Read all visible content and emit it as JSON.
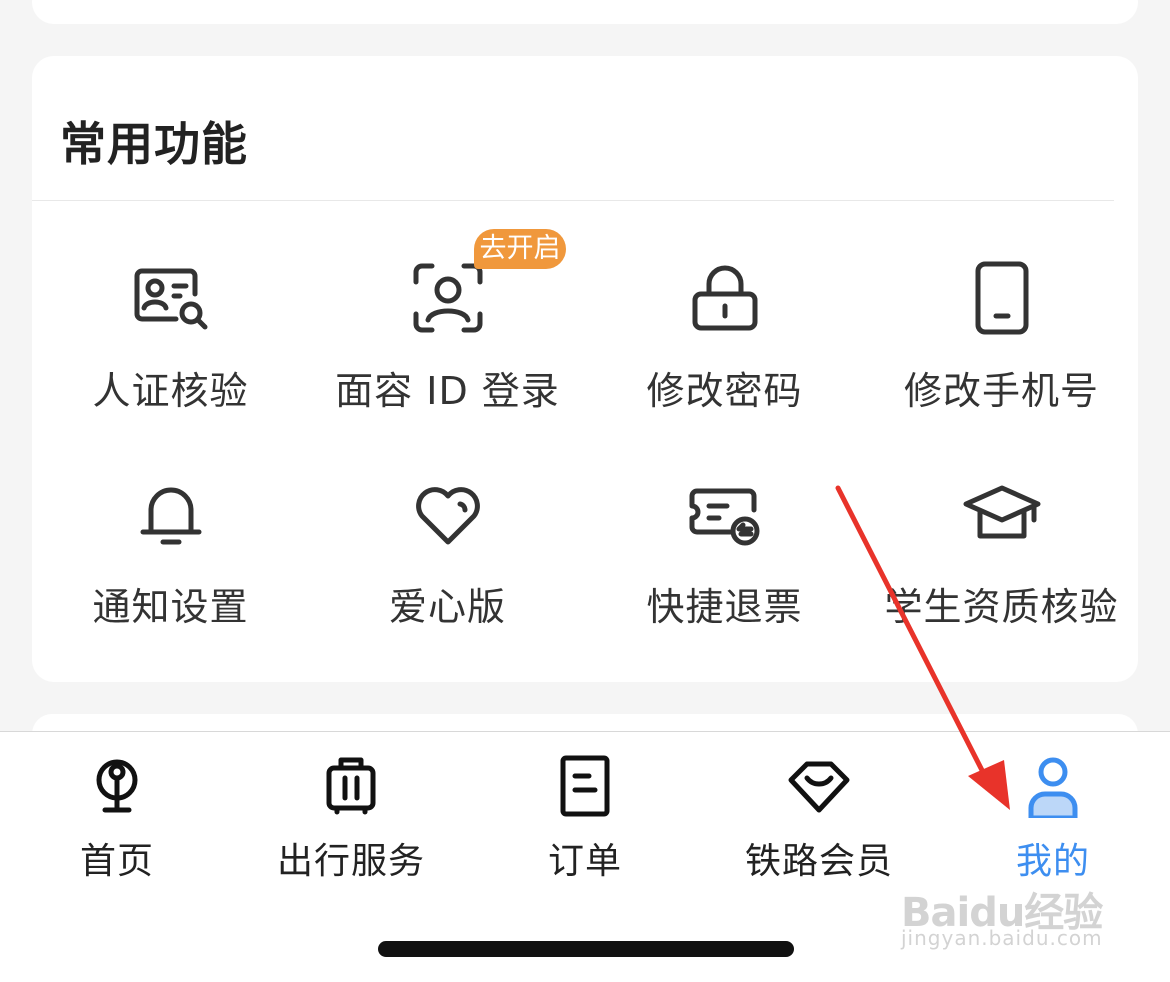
{
  "section": {
    "title": "常用功能",
    "items": [
      {
        "label": "人证核验",
        "icon": "id-card-verify-icon"
      },
      {
        "label": "面容 ID 登录",
        "icon": "face-id-icon",
        "badge": "去开启"
      },
      {
        "label": "修改密码",
        "icon": "lock-icon"
      },
      {
        "label": "修改手机号",
        "icon": "phone-icon"
      },
      {
        "label": "通知设置",
        "icon": "bell-icon"
      },
      {
        "label": "爱心版",
        "icon": "heart-icon"
      },
      {
        "label": "快捷退票",
        "icon": "ticket-refund-icon"
      },
      {
        "label": "学生资质核验",
        "icon": "graduation-cap-icon"
      }
    ]
  },
  "tabbar": {
    "tabs": [
      {
        "label": "首页",
        "icon": "railway-logo-icon"
      },
      {
        "label": "出行服务",
        "icon": "luggage-icon"
      },
      {
        "label": "订单",
        "icon": "order-icon"
      },
      {
        "label": "铁路会员",
        "icon": "diamond-icon"
      },
      {
        "label": "我的",
        "icon": "user-icon",
        "active": true
      }
    ]
  },
  "watermark": {
    "brand": "Baidu经验",
    "url": "jingyan.baidu.com"
  },
  "colors": {
    "accent": "#3d8ef0",
    "badge": "#f0983c",
    "arrow": "#e8332a",
    "icon_stroke": "#333333"
  }
}
